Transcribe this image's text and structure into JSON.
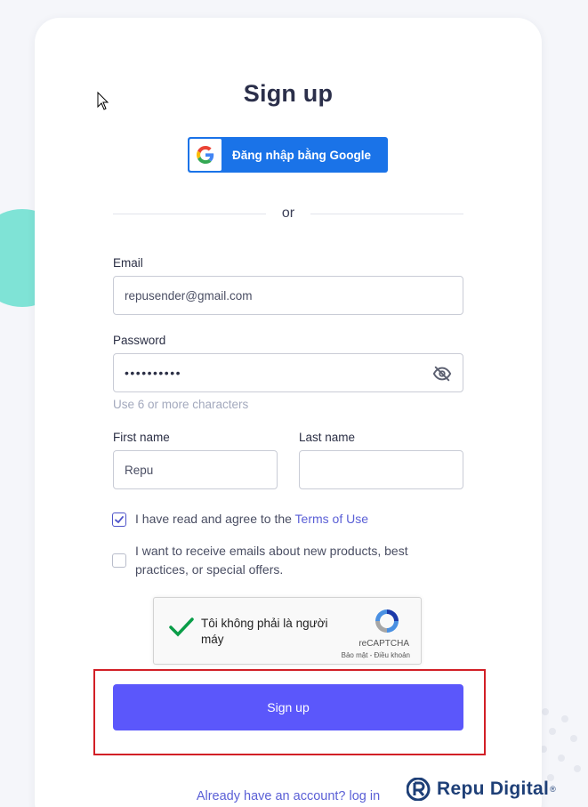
{
  "title": "Sign up",
  "google_button": {
    "label": "Đăng nhập bằng Google"
  },
  "divider": {
    "text": "or"
  },
  "email": {
    "label": "Email",
    "value": "repusender@gmail.com"
  },
  "password": {
    "label": "Password",
    "masked_value": "••••••••••",
    "hint": "Use 6 or more characters",
    "toggle_icon": "eye-off-icon"
  },
  "first_name": {
    "label": "First name",
    "value": "Repu"
  },
  "last_name": {
    "label": "Last name",
    "value": ""
  },
  "terms": {
    "checked": true,
    "text": "I have read and agree to the ",
    "link": "Terms of Use"
  },
  "marketing": {
    "checked": false,
    "text": "I want to receive emails about new products, best practices, or special offers."
  },
  "recaptcha": {
    "text": "Tôi không phải là người máy",
    "brand": "reCAPTCHA",
    "terms": "Bảo mật - Điều khoản",
    "checked": true
  },
  "submit_button": {
    "label": "Sign up"
  },
  "login_link": {
    "text": "Already have an account? log in"
  },
  "watermark": {
    "brand": "Repu Digital",
    "reg": "®"
  },
  "colors": {
    "accent": "#5b57fb",
    "google": "#1a73e8",
    "highlight": "#d21f26",
    "teal": "#7fe3d6",
    "brand_blue": "#1e3f77"
  }
}
